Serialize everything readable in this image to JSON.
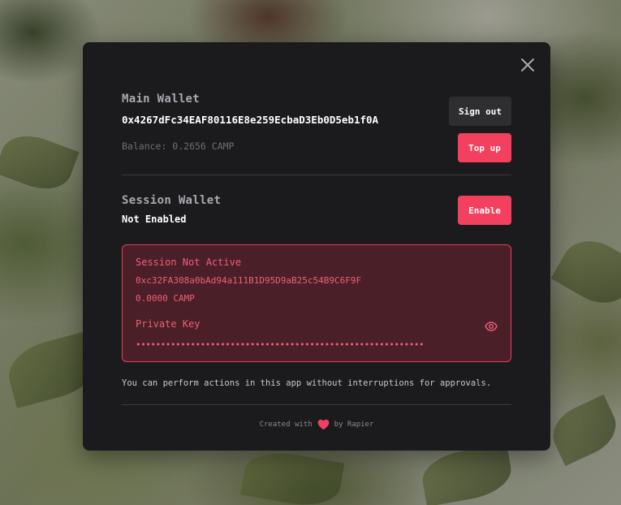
{
  "main_wallet": {
    "title": "Main Wallet",
    "address": "0x4267dFc34EAF80116E8e259EcbaD3Eb0D5eb1f0A",
    "balance": "Balance: 0.2656 CAMP",
    "sign_out_label": "Sign out",
    "top_up_label": "Top up"
  },
  "session_wallet": {
    "title": "Session Wallet",
    "status": "Not Enabled",
    "enable_label": "Enable",
    "box": {
      "title": "Session Not Active",
      "address": "0xc32FA308a0bAd94a111B1D95D9aB25c54B9C6F9F",
      "balance": "0.0000 CAMP",
      "private_key_label": "Private Key",
      "private_key_masked": "••••••••••••••••••••••••••••••••••••••••••••••••••••••••••"
    }
  },
  "info_text": "You can perform actions in this app without interruptions for approvals.",
  "footer": {
    "created_with": "Created with",
    "by": "by Rapier"
  },
  "icons": {
    "close": "close-icon",
    "eye": "eye-icon",
    "heart": "heart-icon"
  },
  "colors": {
    "accent": "#f2405e",
    "modal_bg": "#1b1b1d",
    "session_box_bg": "#4a1f28"
  }
}
